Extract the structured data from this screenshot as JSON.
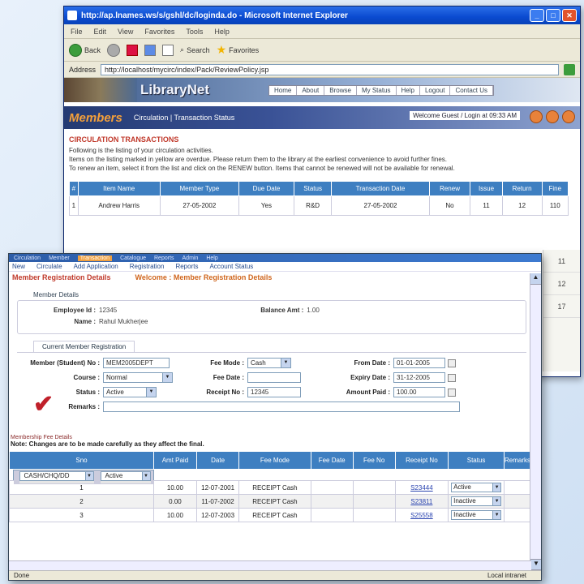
{
  "back_window": {
    "title": "http://ap.lnames.ws/s/gshl/dc/loginda.do - Microsoft Internet Explorer",
    "menu": [
      "File",
      "Edit",
      "View",
      "Favorites",
      "Tools",
      "Help"
    ],
    "toolbar": {
      "back": "Back",
      "search": "Search",
      "favorites": "Favorites"
    },
    "address_label": "Address",
    "address": "http://localhost/mycirc/index/Pack/ReviewPolicy.jsp",
    "app_name": "LibraryNet",
    "nav": [
      "Home",
      "About",
      "Browse",
      "My Status",
      "Help",
      "Logout",
      "Contact Us"
    ],
    "section_badge": "Members",
    "section_sub": "Circulation | Transaction Status",
    "member_info": "Welcome Guest / Login at 09:33 AM",
    "circ_title": "CIRCULATION TRANSACTIONS",
    "circ_text_1": "Following is the listing of your circulation activities.",
    "circ_text_2": "Items on the listing marked in yellow are overdue. Please return them to the library at the earliest convenience to avoid further fines.",
    "circ_text_3": "To renew an item, select it from the list and click on the RENEW button. Items that cannot be renewed will not be available for renewal.",
    "table_headers": [
      "#",
      "Item Name",
      "Member Type",
      "Due Date",
      "Status",
      "Transaction Date",
      "Renew",
      "Issue",
      "Return",
      "Fine"
    ],
    "table_row": [
      "1",
      "Andrew Harris",
      "27-05-2002",
      "Yes",
      "R&D",
      "27-05-2002",
      "No",
      "11",
      "12",
      "110"
    ],
    "side_values": [
      "11",
      "12",
      "17"
    ]
  },
  "front_window": {
    "topbar": [
      "Circulation",
      "Member",
      "Transaction",
      "Catalogue",
      "Reports",
      "Admin",
      "Help"
    ],
    "menu": [
      "New",
      "Circulate",
      "Add Application",
      "Registration",
      "Reports",
      "Account Status"
    ],
    "crumb_1": "Member Registration Details",
    "crumb_2": "Welcome : Member Registration Details",
    "panel_title": "Member Details",
    "employee_id_label": "Employee Id :",
    "employee_id": "12345",
    "name_label": "Name :",
    "name": "Rahul Mukherjee",
    "balance_label": "Balance Amt :",
    "balance": "1.00",
    "tab_label": "Current Member Registration",
    "form": {
      "member_no_label": "Member (Student) No :",
      "member_no": "MEM2005DEPT",
      "course_label": "Course :",
      "course": "Normal",
      "status_label": "Status :",
      "status": "Active",
      "remarks_label": "Remarks :",
      "remarks": "",
      "fee_mode_label": "Fee Mode :",
      "fee_mode": "Cash",
      "fee_date_label": "Fee Date :",
      "fee_date": "",
      "receipt_no_label": "Receipt No :",
      "receipt_no": "12345",
      "from_date_label": "From Date :",
      "from_date": "01-01-2005",
      "expiry_date_label": "Expiry Date :",
      "expiry_date": "31-12-2005",
      "amount_paid_label": "Amount Paid :",
      "amount_paid": "100.00"
    },
    "grid_hint": "Membership Fee Details",
    "grid_hint_2": "Note: Changes are to be made carefully as they affect the final.",
    "grid_headers": [
      "Sno",
      "Amt Paid",
      "Date",
      "Fee Mode",
      "Fee Date",
      "Fee No",
      "Receipt No",
      "Status",
      "Remarks"
    ],
    "grid_filter": {
      "fee_mode": "CASH/CHQ/DD",
      "status": "Active"
    },
    "grid_rows": [
      {
        "sno": "1",
        "amt": "10.00",
        "date": "12-07-2001",
        "mode": "RECEIPT Cash",
        "receipt": "S23444",
        "status": "Active"
      },
      {
        "sno": "2",
        "amt": "0.00",
        "date": "11-07-2002",
        "mode": "RECEIPT Cash",
        "receipt": "S23811",
        "status": "Inactive"
      },
      {
        "sno": "3",
        "amt": "10.00",
        "date": "12-07-2003",
        "mode": "RECEIPT Cash",
        "receipt": "S25558",
        "status": "Inactive"
      }
    ],
    "status_left": "Done",
    "status_right": "Local intranet"
  }
}
